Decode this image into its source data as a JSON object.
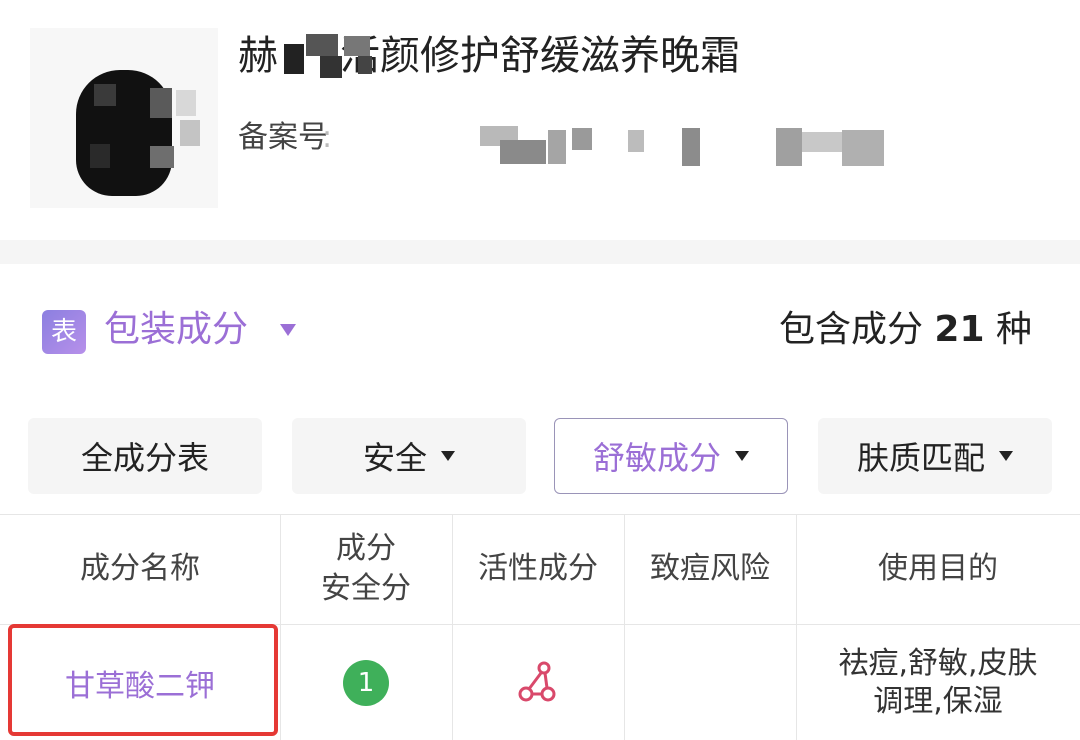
{
  "product": {
    "title_start": "赫",
    "title_end": "活颜修护舒缓滋养晚霜",
    "registration_label": "备案号"
  },
  "section": {
    "icon_char": "表",
    "title": "包装成分",
    "count_prefix": "包含成分",
    "count_value": "21",
    "count_suffix": "种"
  },
  "filters": [
    {
      "label": "全成分表",
      "has_dropdown": false,
      "active": false
    },
    {
      "label": "安全",
      "has_dropdown": true,
      "active": false
    },
    {
      "label": "舒敏成分",
      "has_dropdown": true,
      "active": true
    },
    {
      "label": "肤质匹配",
      "has_dropdown": true,
      "active": false
    }
  ],
  "table": {
    "headers": [
      "成分名称",
      "成分\n安全分",
      "活性成分",
      "致痘风险",
      "使用目的"
    ],
    "rows": [
      {
        "name": "甘草酸二钾",
        "safety_score": "1",
        "active_icon": "molecule-icon",
        "acne_risk": "",
        "purpose_line1": "祛痘,舒敏,皮肤",
        "purpose_line2": "调理,保湿"
      }
    ]
  },
  "colors": {
    "accent": "#9b6fd6",
    "highlight": "#e53935",
    "score_green": "#3fb05a",
    "active_icon": "#d9496b"
  }
}
